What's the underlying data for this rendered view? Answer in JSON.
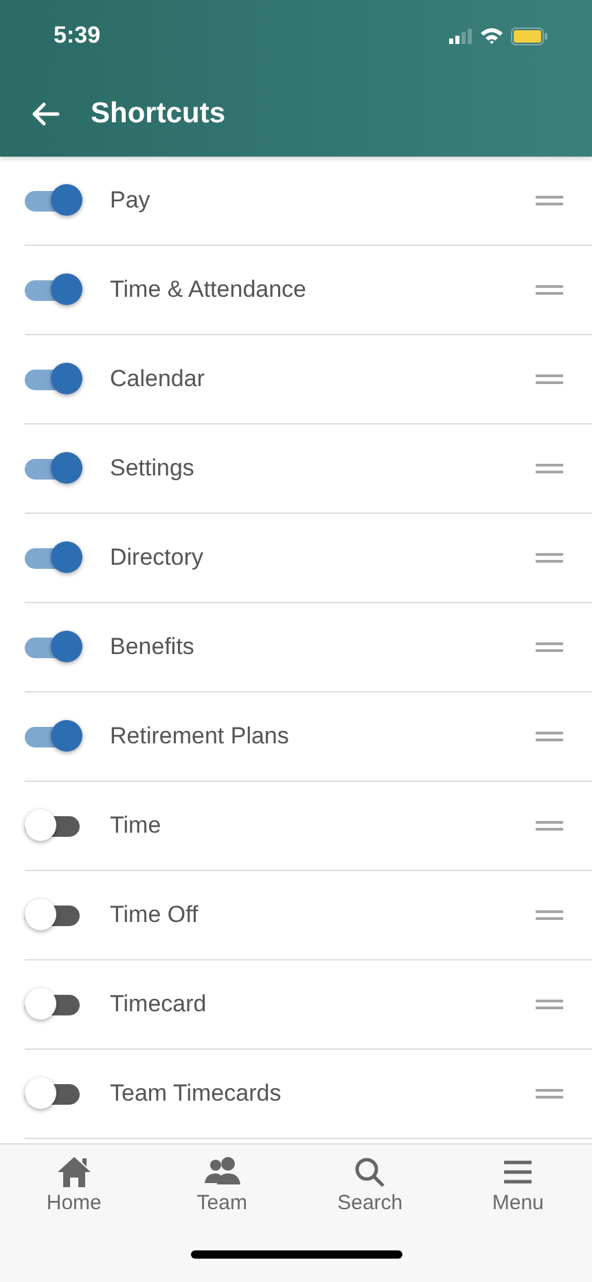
{
  "status_bar": {
    "time": "5:39"
  },
  "header": {
    "title": "Shortcuts"
  },
  "shortcuts": [
    {
      "label": "Pay",
      "on": true
    },
    {
      "label": "Time & Attendance",
      "on": true
    },
    {
      "label": "Calendar",
      "on": true
    },
    {
      "label": "Settings",
      "on": true
    },
    {
      "label": "Directory",
      "on": true
    },
    {
      "label": "Benefits",
      "on": true
    },
    {
      "label": "Retirement Plans",
      "on": true
    },
    {
      "label": "Time",
      "on": false
    },
    {
      "label": "Time Off",
      "on": false
    },
    {
      "label": "Timecard",
      "on": false
    },
    {
      "label": "Team Timecards",
      "on": false
    }
  ],
  "tab_bar": [
    {
      "kind": "home",
      "label": "Home"
    },
    {
      "kind": "team",
      "label": "Team"
    },
    {
      "kind": "search",
      "label": "Search"
    },
    {
      "kind": "menu",
      "label": "Menu"
    }
  ]
}
